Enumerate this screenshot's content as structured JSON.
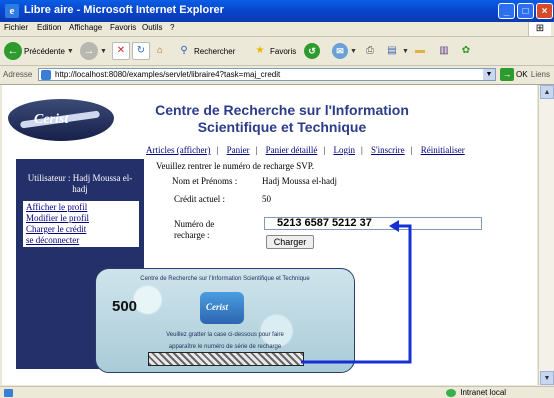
{
  "window": {
    "title": "Libre aire - Microsoft Internet Explorer"
  },
  "menu": [
    "Fichier",
    "Edition",
    "Affichage",
    "Favoris",
    "Outils",
    "?"
  ],
  "toolbar": {
    "back_label": "Précédente",
    "search_label": "Rechercher",
    "favorites_label": "Favoris"
  },
  "address": {
    "label": "Adresse",
    "url": "http://localhost:8080/examples/servlet/libraire4?task=maj_credit",
    "go_label": "OK",
    "links_label": "Liens"
  },
  "site": {
    "title_line1": "Centre de Recherche sur l'Information",
    "title_line2": "Scientifique et Technique",
    "logo_text": "Cerist"
  },
  "nav": [
    "Articles (afficher)",
    "Panier",
    "Panier détaillé",
    "Login",
    "S'inscrire",
    "Réinitialiser"
  ],
  "sidebar": {
    "user": "Utilisateur : Hadj Moussa el-hadj",
    "links": [
      "Afficher le profil",
      "Modifier le profil",
      "Charger le crédit",
      "se déconnecter"
    ]
  },
  "form": {
    "prompt": "Veuillez rentrer le numéro de recharge SVP.",
    "name_label": "Nom et Prénoms :",
    "name_value": "Hadj Moussa el-hadj",
    "credit_label": "Crédit actuel :",
    "credit_value": "50",
    "recharge_label_1": "Numéro de",
    "recharge_label_2": "recharge :",
    "recharge_value": "5213 6587 5212 37",
    "charger_label": "Charger"
  },
  "card": {
    "title": "Centre de Recherche sur l'Information Scientifique et Technique",
    "amount": "500",
    "logo_text": "Cerist",
    "instructions_1": "Veuillez gratter la case ci-dessous pour faire",
    "instructions_2": "apparaître le numéro de série de recharge"
  },
  "status": {
    "zone": "Intranet local"
  }
}
